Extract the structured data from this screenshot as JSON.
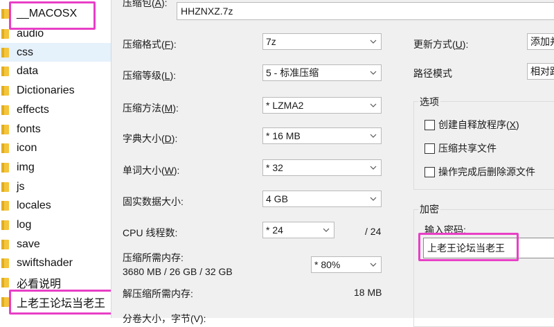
{
  "explorer": {
    "items": [
      {
        "label": "__MACOSX",
        "selected": false
      },
      {
        "label": "audio",
        "selected": false
      },
      {
        "label": "css",
        "selected": true
      },
      {
        "label": "data",
        "selected": false
      },
      {
        "label": "Dictionaries",
        "selected": false
      },
      {
        "label": "effects",
        "selected": false
      },
      {
        "label": "fonts",
        "selected": false
      },
      {
        "label": "icon",
        "selected": false
      },
      {
        "label": "img",
        "selected": false
      },
      {
        "label": "js",
        "selected": false
      },
      {
        "label": "locales",
        "selected": false
      },
      {
        "label": "log",
        "selected": false
      },
      {
        "label": "save",
        "selected": false
      },
      {
        "label": "swiftshader",
        "selected": false
      },
      {
        "label": "必看说明",
        "selected": false
      },
      {
        "label": "上老王论坛当老王",
        "selected": false
      }
    ]
  },
  "dialog": {
    "archive": {
      "label": "压缩包(",
      "hotkey": "A",
      "label_end": "):",
      "value": "HHZNXZ.7z"
    },
    "format": {
      "label": "压缩格式(",
      "hotkey": "F",
      "label_end": "):",
      "value": "7z"
    },
    "level": {
      "label": "压缩等级(",
      "hotkey": "L",
      "label_end": "):",
      "value": "5 - 标准压缩"
    },
    "method": {
      "label": "压缩方法(",
      "hotkey": "M",
      "label_end": "):",
      "value": "*  LZMA2"
    },
    "dict": {
      "label": "字典大小(",
      "hotkey": "D",
      "label_end": "):",
      "value": "*  16 MB"
    },
    "word": {
      "label": "单词大小(",
      "hotkey": "W",
      "label_end": "):",
      "value": "*  32"
    },
    "solid": {
      "label": "固实数据大小:",
      "value": "4 GB"
    },
    "threads": {
      "label": "CPU 线程数:",
      "value": "*  24",
      "max": "/ 24"
    },
    "mem_compress": {
      "label": "压缩所需内存:",
      "detail": "3680 MB / 26 GB / 32 GB",
      "value": "* 80%"
    },
    "mem_decompress": {
      "label": "解压缩所需内存:",
      "value": "18 MB"
    },
    "split": {
      "label": "分卷大小，字节(V):"
    },
    "update": {
      "label": "更新方式(",
      "hotkey": "U",
      "label_end": "):",
      "value": "添加并"
    },
    "path_mode": {
      "label": "路径模式",
      "value": "相对路"
    },
    "options": {
      "title": "选项",
      "sfx": {
        "label": "创建自释放程序(",
        "hotkey": "X",
        "label_end": ")",
        "checked": false
      },
      "shared": {
        "label": "压缩共享文件",
        "checked": false
      },
      "delete": {
        "label": "操作完成后删除源文件",
        "checked": false
      }
    },
    "encryption": {
      "title": "加密",
      "password_label": "输入密码:",
      "password_value": "上老王论坛当老王"
    }
  },
  "colors": {
    "highlight": "#e83fc6",
    "folder": "#f4c53c",
    "selected_row": "#e5f1fb",
    "dialog_bg": "#f0f0f0"
  }
}
